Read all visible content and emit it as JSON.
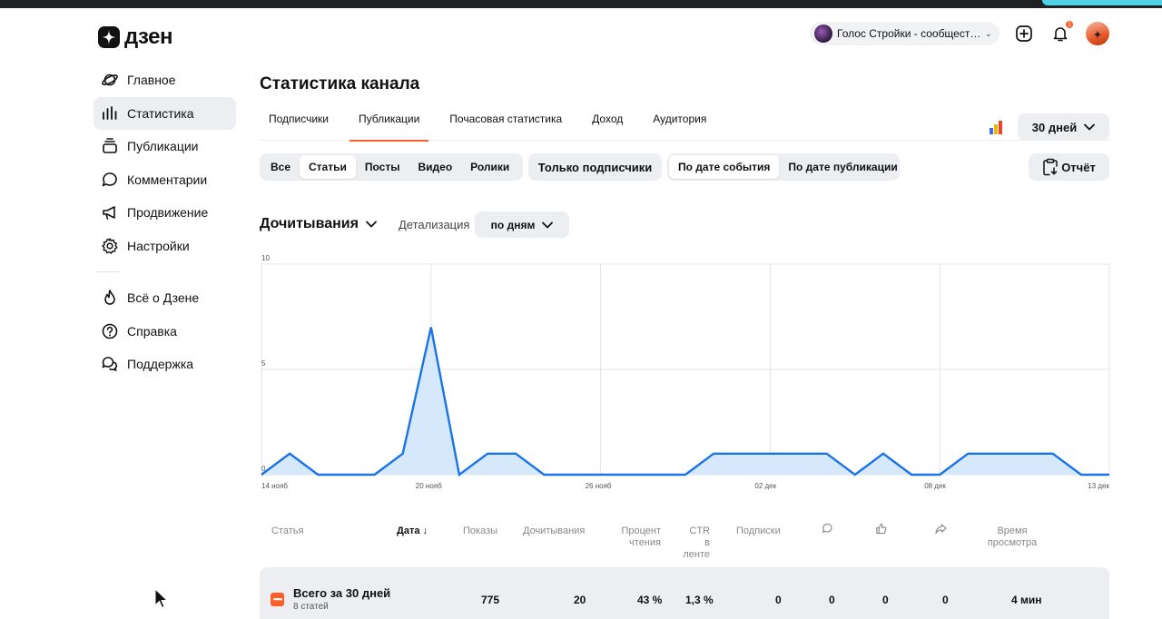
{
  "brand": {
    "name": "дзен"
  },
  "header": {
    "channel_name": "Голос Стройки - сообщест…",
    "notifications_count": "1"
  },
  "sidebar": {
    "items": [
      {
        "label": "Главное",
        "icon": "planet-icon"
      },
      {
        "label": "Статистика",
        "icon": "bar-chart-icon",
        "active": true
      },
      {
        "label": "Публикации",
        "icon": "stack-icon"
      },
      {
        "label": "Комментарии",
        "icon": "comment-icon"
      },
      {
        "label": "Продвижение",
        "icon": "megaphone-icon"
      },
      {
        "label": "Настройки",
        "icon": "gear-icon"
      }
    ],
    "secondary": [
      {
        "label": "Всё о Дзене",
        "icon": "flame-icon"
      },
      {
        "label": "Справка",
        "icon": "question-icon"
      },
      {
        "label": "Поддержка",
        "icon": "chat-bubbles-icon"
      }
    ]
  },
  "page": {
    "title": "Статистика канала"
  },
  "tabs": [
    "Подписчики",
    "Публикации",
    "Почасовая статистика",
    "Доход",
    "Аудитория"
  ],
  "active_tab": "Публикации",
  "period": "30 дней",
  "filters": {
    "types": [
      "Все",
      "Статьи",
      "Посты",
      "Видео",
      "Ролики"
    ],
    "active_type": "Статьи",
    "subscribers_only": "Только подписчики",
    "date_modes": [
      "По дате события",
      "По дате публикации"
    ],
    "active_date_mode": "По дате события",
    "report": "Отчёт"
  },
  "metric": {
    "selected": "Дочитывания",
    "detail_label": "Детализация",
    "detail_value": "по дням"
  },
  "chart_data": {
    "type": "area",
    "ylim": [
      0,
      10
    ],
    "y_ticks": [
      "0",
      "5",
      "10"
    ],
    "x_ticks": [
      "14 нояб",
      "20 нояб",
      "26 нояб",
      "02 дек",
      "08 дек",
      "13 дек"
    ],
    "x": [
      "14 нояб",
      "15 нояб",
      "16 нояб",
      "17 нояб",
      "18 нояб",
      "19 нояб",
      "20 нояб",
      "21 нояб",
      "22 нояб",
      "23 нояб",
      "24 нояб",
      "25 нояб",
      "26 нояб",
      "27 нояб",
      "28 нояб",
      "29 нояб",
      "30 нояб",
      "01 дек",
      "02 дек",
      "03 дек",
      "04 дек",
      "05 дек",
      "06 дек",
      "07 дек",
      "08 дек",
      "09 дек",
      "10 дек",
      "11 дек",
      "12 дек",
      "13 дек"
    ],
    "values": [
      0,
      1,
      0,
      0,
      0,
      1,
      7,
      0,
      1,
      1,
      0,
      0,
      0,
      0,
      0,
      0,
      1,
      1,
      1,
      1,
      1,
      0,
      1,
      0,
      0,
      1,
      1,
      1,
      1,
      0,
      0
    ],
    "colors": {
      "line": "#1a73e8",
      "fill": "#d6e8fc"
    }
  },
  "table": {
    "columns": [
      "Статья",
      "Дата",
      "Показы",
      "Дочитывания",
      "Процент\nчтения",
      "CTR\nв ленте",
      "Подписки",
      "comment-icon",
      "like-icon",
      "share-icon",
      "Время\nпросмотра"
    ],
    "sort_column": "Дата",
    "total": {
      "title": "Всего за 30 дней",
      "subtitle": "8 статей",
      "shows": "775",
      "reads": "20",
      "read_percent": "43 %",
      "ctr": "1,3 %",
      "subscriptions": "0",
      "comments": "0",
      "likes": "0",
      "shares": "0",
      "watch_time": "4 мин"
    }
  }
}
